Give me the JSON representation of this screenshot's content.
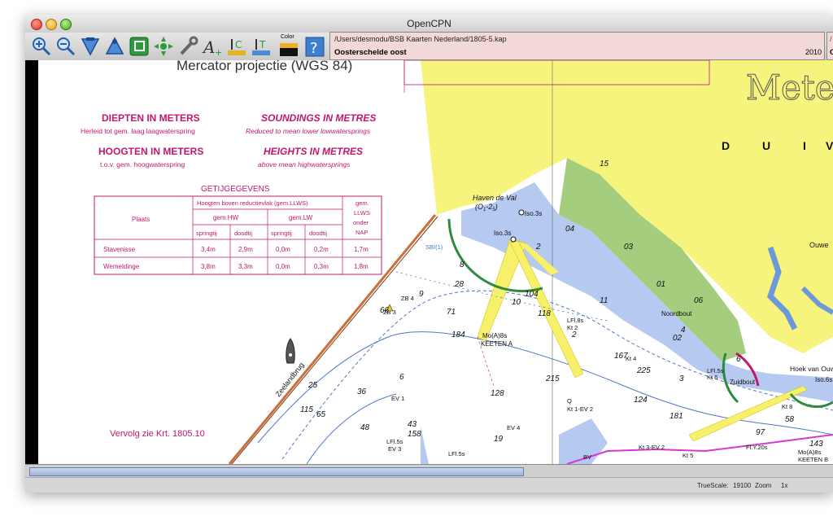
{
  "window": {
    "title": "OpenCPN"
  },
  "toolbar": {
    "tools": [
      {
        "icon": "zoom-in-icon"
      },
      {
        "icon": "zoom-out-icon"
      },
      {
        "icon": "scale-in-icon"
      },
      {
        "icon": "scale-out-icon"
      },
      {
        "icon": "chart-outline-icon"
      },
      {
        "icon": "follow-ship-icon"
      },
      {
        "icon": "settings-wrench-icon"
      },
      {
        "icon": "text-toggle-icon"
      },
      {
        "icon": "current-icon"
      },
      {
        "icon": "tide-icon"
      },
      {
        "icon": "color-scheme-icon"
      },
      {
        "icon": "help-icon"
      }
    ],
    "color_label": "Color"
  },
  "chart_info": {
    "path": "/Users/desmodu/BSB Kaarten Nederland/1805-5.kap",
    "name": "Oosterschelde oost",
    "year": "2010",
    "second_panel_top": "/",
    "second_panel_bottom": "O"
  },
  "legend": {
    "projection": "Mercator projectie (WGS 84)",
    "depths_nl": "DIEPTEN IN METERS",
    "depths_nl_sub": "Herleid tot gem. laag laagwaterspring",
    "soundings_en": "SOUNDINGS IN METRES",
    "soundings_en_sub": "Reduced to mean lower lowwatersprings",
    "heights_nl": "HOOGTEN IN METERS",
    "heights_nl_sub": "t.o.v. gem. hoogwaterspring",
    "heights_en": "HEIGHTS IN METRES",
    "heights_en_sub": "above mean highwatersprings",
    "continuation": "Vervolg zie Krt. 1805.10"
  },
  "tide_table": {
    "title": "GETIJGEGEVENS",
    "header_place": "Plaats",
    "header_group": "Hoogten boven reductievlak (gem.LLWS)",
    "header_llws": [
      "gem.",
      "LLWS",
      "onder",
      "NAP"
    ],
    "header_hw": "gem.HW",
    "header_lw": "gem.LW",
    "sub_headers": [
      "springtij",
      "doodtij",
      "springtij",
      "doodtij"
    ],
    "rows": [
      {
        "place": "Stavenisse",
        "values": [
          "3,4m",
          "2,9m",
          "0,0m",
          "0,2m",
          "1,7m"
        ]
      },
      {
        "place": "Wemeldinge",
        "values": [
          "3,8m",
          "3,3m",
          "0,0m",
          "0,3m",
          "1,8m"
        ]
      }
    ]
  },
  "map_labels": {
    "big_title": "Meter",
    "region": [
      "D",
      "U",
      "I",
      "V"
    ],
    "haven": "Haven de Val",
    "haven_light": "(O",
    "haven_light_sub": "1",
    "haven_light_mid": "-2",
    "haven_light_sub2": "5",
    "haven_light_end": ")",
    "iso3s_a": "Iso.3s",
    "iso3s_b": "Iso.3s",
    "zb4": "ZB 4",
    "zb3": "ZB 3",
    "moa": "Mo(A)8s",
    "keeten_a": "KEETEN A",
    "lfl8s": "LFl.8s",
    "kt2": "Kt 2",
    "kt4": "Kt 4",
    "kt6": "Kt 6",
    "kt8": "Kt 8",
    "kt5": "Kt 5",
    "kt3ev2": "Kt 3-EV 2",
    "kt1ev2": "Kt 1-EV 2",
    "q": "Q",
    "ev1": "EV 1",
    "ev3": "EV 3",
    "ev4": "EV 4",
    "lfl5s": "LFl.5s",
    "lfl5s_b": "LFl.5s",
    "lfl5s_c": "LFl.5s",
    "fly20s": "Fl.Y.20s",
    "mo_b": "Mo(A)8s",
    "keeten_b": "KEETEN B",
    "noordbout": "Noordbout",
    "zuidbout": "Zuidbout",
    "hoek": "Hoek van Ouwer",
    "iso6s": "Iso.6s",
    "ouwe": "Ouwe",
    "zeelandbrug": "Zeelandbrug",
    "sbi": "SBI(1)",
    "bv": "BV",
    "soundings": [
      "15",
      "04",
      "03",
      "01",
      "06",
      "02",
      "11",
      "10",
      "104",
      "118",
      "184",
      "167",
      "225",
      "215",
      "128",
      "124",
      "181",
      "58",
      "97",
      "143",
      "115",
      "65",
      "43",
      "36",
      "28",
      "158",
      "25",
      "6",
      "71",
      "3",
      "4",
      "6",
      "8",
      "9",
      "66",
      "48",
      "19",
      "2",
      "2"
    ]
  },
  "progress": {
    "value": 1.0
  },
  "status": {
    "truescale_label": "TrueScale:",
    "truescale_value": "19100",
    "zoom_label": "Zoom",
    "zoom_value": "1x"
  },
  "colors": {
    "land": "#f7f47e",
    "shallow_blue": "#b6c9f0",
    "drying_green": "#9fca7b",
    "deep_white": "#ffffff",
    "legend_magenta": "#c0186b",
    "progress": "#9fb2d8"
  }
}
